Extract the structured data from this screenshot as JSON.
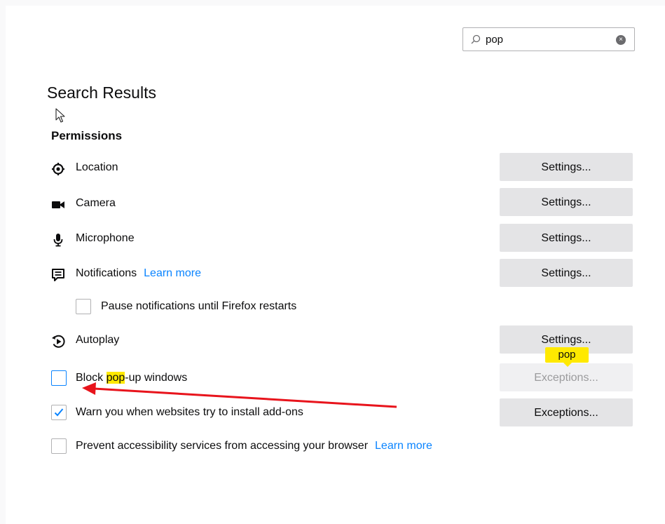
{
  "search": {
    "value": "pop",
    "clear_icon": "×"
  },
  "title": "Search Results",
  "permissions_heading": "Permissions",
  "permissions": [
    {
      "label": "Location",
      "icon": "location-icon",
      "button": "Settings..."
    },
    {
      "label": "Camera",
      "icon": "camera-icon",
      "button": "Settings..."
    },
    {
      "label": "Microphone",
      "icon": "microphone-icon",
      "button": "Settings..."
    },
    {
      "label": "Notifications",
      "icon": "notifications-icon",
      "button": "Settings...",
      "link": "Learn more"
    },
    {
      "label": "Autoplay",
      "icon": "autoplay-icon",
      "button": "Settings..."
    }
  ],
  "pause_notifications": {
    "label": "Pause notifications until Firefox restarts",
    "checked": false
  },
  "block_popups": {
    "label_before": "Block ",
    "label_highlight": "pop",
    "label_after": "-up windows",
    "checked": false,
    "button": "Exceptions..."
  },
  "warn_addons": {
    "label": "Warn you when websites try to install add-ons",
    "checked": true,
    "button": "Exceptions..."
  },
  "prevent_accessibility": {
    "label": "Prevent accessibility services from accessing your browser",
    "link": "Learn more",
    "checked": false
  },
  "tooltip": "pop",
  "colors": {
    "accent": "#0a84ff",
    "highlight": "#ffe900",
    "annotation_arrow": "#e8141c"
  }
}
